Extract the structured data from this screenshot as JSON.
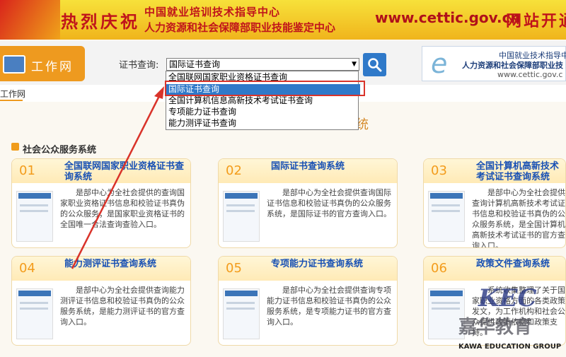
{
  "top_banner": {
    "greeting": "热烈庆祝",
    "line1": "中国就业培训技术指导中心",
    "line2": "人力资源和社会保障部职业技能鉴定中心",
    "url": "www.cettic.gov.cn",
    "open_text": "网站开通"
  },
  "header": {
    "logo_text": "工作网",
    "search_label": "证书查询:",
    "search_value": "国际证书查询",
    "right_logo": {
      "line1": "中国就业技术指导中",
      "line2": "人力资源和社会保障部职业技",
      "line3": "www.cettic.gov.c"
    }
  },
  "dropdown": {
    "options": [
      "全国联网国家职业资格证书查询",
      "国际证书查询",
      "全国计算机信息高新技术考试证书查询",
      "专项能力证书查询",
      "能力测评证书查询"
    ],
    "selected_index": 1
  },
  "nav": {
    "active_tab": "工作网",
    "partial_heading": "统"
  },
  "section": {
    "title": "社会公众服务系统"
  },
  "cards": [
    {
      "num": "01",
      "title": "全国联网国家职业资格证书查询系统",
      "desc": "是部中心为全社会提供的查询国家职业资格证书信息和校验证书真伪的公众服务；是国家职业资格证书的全国唯一合法查询查验入口。"
    },
    {
      "num": "02",
      "title": "国际证书查询系统",
      "desc": "是部中心为全社会提供查询国际证书信息和校验证书真伪的公众服务系统，是国际证书的官方查询入口。"
    },
    {
      "num": "03",
      "title": "全国计算机高新技术考试证书查询系统",
      "desc": "是部中心为全社会提供查询计算机高新技术考试证书信息和校验证书真伪的公众服务系统，是全国计算机高新技术考试证书的官方查询入口。"
    },
    {
      "num": "04",
      "title": "能力测评证书查询系统",
      "desc": "是部中心为全社会提供查询能力测评证书信息和校验证书真伪的公众服务系统，是能力测评证书的官方查询入口。"
    },
    {
      "num": "05",
      "title": "专项能力证书查询系统",
      "desc": "是部中心为全社会提供查询专项能力证书信息和校验证书真伪的公众服务系统，是专项能力证书的官方查询入口。"
    },
    {
      "num": "06",
      "title": "政策文件查询系统",
      "desc": "系统收集整理了关于国家职业资格方面的各类政策发文，为工作机构和社会公众提供政策依据和政策支持。"
    }
  ],
  "watermark": {
    "brand": "KEC",
    "cn": "嘉华教育",
    "en": "KAWA EDUCATION GROUP"
  },
  "colors": {
    "accent_orange": "#ee9a1f",
    "link_blue": "#1750b4",
    "highlight_red": "#d9332a",
    "selected_blue": "#2f79c9"
  }
}
